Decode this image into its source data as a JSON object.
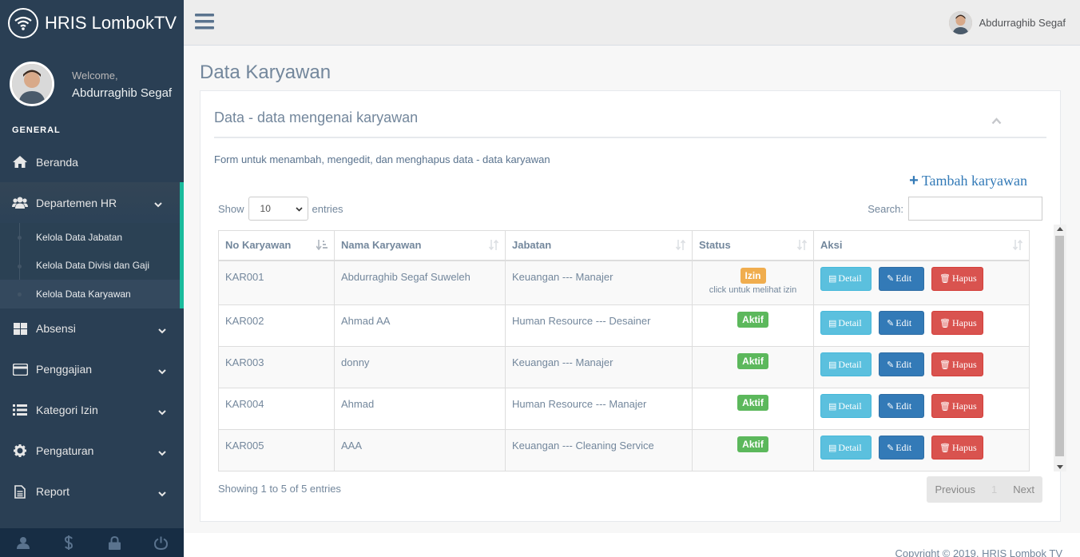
{
  "app": {
    "title": "HRIS LombokTV"
  },
  "profile": {
    "welcome": "Welcome,",
    "name": "Abdurraghib Segaf"
  },
  "sidebar": {
    "section_title": "GENERAL",
    "items": [
      {
        "label": "Beranda",
        "icon": "home-icon"
      },
      {
        "label": "Departemen HR",
        "icon": "users-icon"
      },
      {
        "label": "Absensi",
        "icon": "table-icon"
      },
      {
        "label": "Penggajian",
        "icon": "credit-card-icon"
      },
      {
        "label": "Kategori Izin",
        "icon": "list-icon"
      },
      {
        "label": "Pengaturan",
        "icon": "gear-icon"
      },
      {
        "label": "Report",
        "icon": "file-icon"
      }
    ],
    "submenu": [
      "Kelola Data Jabatan",
      "Kelola Data Divisi dan Gaji",
      "Kelola Data Karyawan"
    ],
    "footer_icons": [
      "user-icon",
      "dollar-icon",
      "lock-icon",
      "power-icon"
    ]
  },
  "topnav": {
    "user_name": "Abdurraghib Segaf"
  },
  "page": {
    "title": "Data Karyawan",
    "panel_title": "Data - data mengenai karyawan",
    "description": "Form untuk menambah, mengedit, dan menghapus data - data karyawan",
    "add_label": "Tambah karyawan"
  },
  "table": {
    "show_label": "Show",
    "entries_label": "entries",
    "page_length": "10",
    "search_label": "Search:",
    "columns": [
      "No Karyawan",
      "Nama Karyawan",
      "Jabatan",
      "Status",
      "Aksi"
    ],
    "rows": [
      {
        "no": "KAR001",
        "nama": "Abdurraghib Segaf Suweleh",
        "jabatan": "Keuangan --- Manajer",
        "status": "Izin",
        "hint": "click untuk melihat izin"
      },
      {
        "no": "KAR002",
        "nama": "Ahmad AA",
        "jabatan": "Human Resource --- Desainer",
        "status": "Aktif"
      },
      {
        "no": "KAR003",
        "nama": "donny",
        "jabatan": "Keuangan --- Manajer",
        "status": "Aktif"
      },
      {
        "no": "KAR004",
        "nama": "Ahmad",
        "jabatan": "Human Resource --- Manajer",
        "status": "Aktif"
      },
      {
        "no": "KAR005",
        "nama": "AAA",
        "jabatan": "Keuangan --- Cleaning Service",
        "status": "Aktif"
      }
    ],
    "actions": {
      "detail": "Detail",
      "edit": "Edit",
      "hapus": "Hapus"
    },
    "info": "Showing 1 to 5 of 5 entries",
    "pager": {
      "previous": "Previous",
      "page": "1",
      "next": "Next"
    }
  },
  "footer": {
    "text": "Copyright © 2019, HRIS Lombok TV"
  },
  "colors": {
    "sidebar": "#2a3f54",
    "accent": "#1abb9c",
    "detail": "#5bc0de",
    "edit": "#337ab7",
    "hapus": "#d9534f",
    "izin": "#f0ad4e",
    "aktif": "#5cb85c"
  }
}
